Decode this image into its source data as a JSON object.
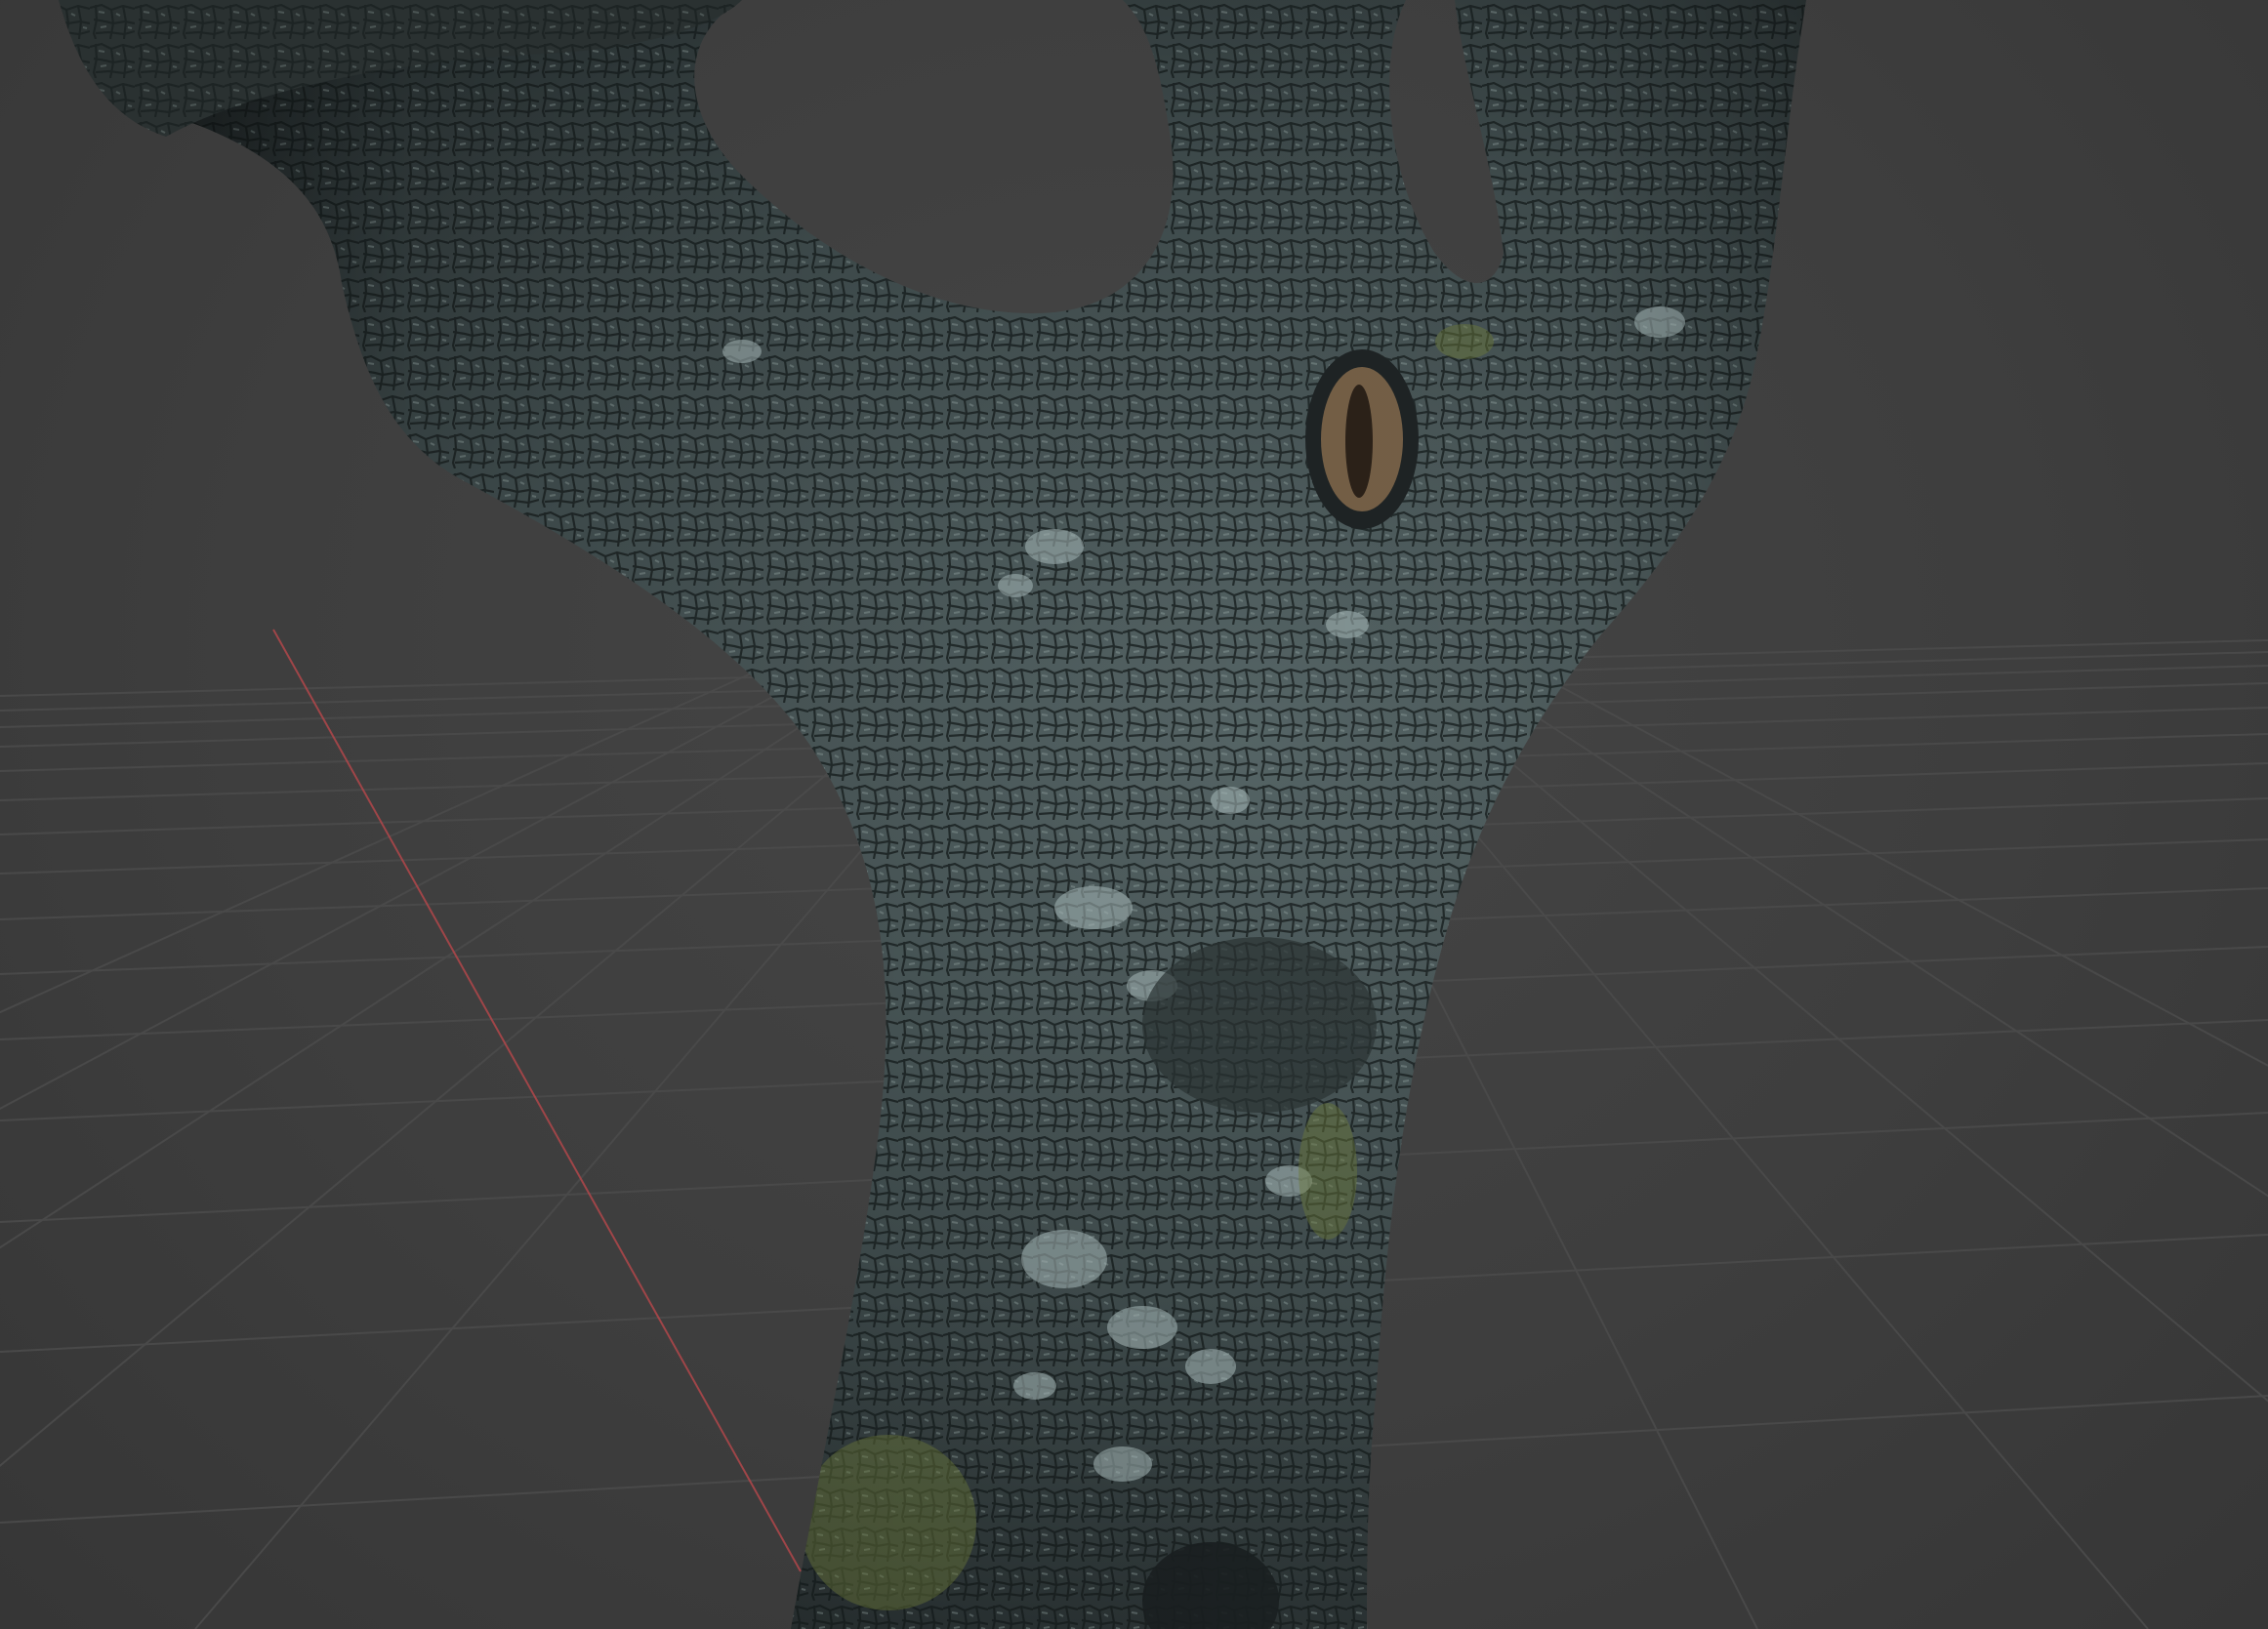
{
  "viewport": {
    "kind": "3d-viewport",
    "background_color": "#3d3d3d",
    "grid_color": "#4a4a4a",
    "axis_x_color": "#b0474a",
    "object": "tree-trunk-mesh",
    "bark_colors": {
      "base": "#3f4a4b",
      "dark": "#252b2c",
      "light": "#7f9392",
      "lichen": "#a9bbbb",
      "moss": "#6d7a3a",
      "knot": "#8a6e4f"
    }
  }
}
